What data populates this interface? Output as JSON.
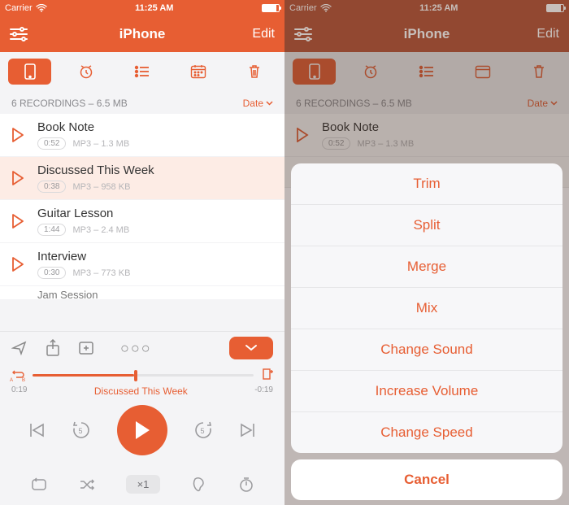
{
  "accent": "#e75e33",
  "status": {
    "carrier": "Carrier",
    "time": "11:25 AM"
  },
  "nav": {
    "title": "iPhone",
    "edit": "Edit"
  },
  "info": {
    "summary": "6 RECORDINGS – 6.5 MB",
    "sort_label": "Date"
  },
  "recordings": [
    {
      "title": "Book Note",
      "duration": "0:52",
      "meta": "MP3 – 1.3 MB",
      "selected": false
    },
    {
      "title": "Discussed This Week",
      "duration": "0:38",
      "meta": "MP3 – 958 KB",
      "selected": true
    },
    {
      "title": "Guitar Lesson",
      "duration": "1:44",
      "meta": "MP3 – 2.4 MB",
      "selected": false
    },
    {
      "title": "Interview",
      "duration": "0:30",
      "meta": "MP3 – 773 KB",
      "selected": false
    }
  ],
  "recording_cut": "Jam Session",
  "player": {
    "elapsed": "0:19",
    "remaining": "-0:19",
    "now_playing": "Discussed This Week",
    "rate": "×1"
  },
  "sheet": {
    "items": [
      "Trim",
      "Split",
      "Merge",
      "Mix",
      "Change Sound",
      "Increase Volume",
      "Change Speed"
    ],
    "cancel": "Cancel"
  }
}
